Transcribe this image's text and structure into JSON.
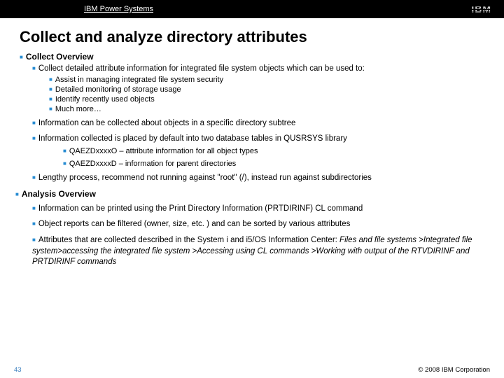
{
  "header": {
    "brand": "IBM Power Systems",
    "logo_text": "IBM"
  },
  "title": "Collect and analyze directory attributes",
  "sections": {
    "collect_overview": {
      "heading": "Collect Overview",
      "items": {
        "collect_detailed": "Collect detailed attribute information for integrated file system objects which can be used to:",
        "sub": {
          "assist": "Assist in managing integrated file system security",
          "monitoring": "Detailed monitoring of storage usage",
          "identify": "Identify recently used objects",
          "more": "Much more…"
        },
        "subtree": "Information can be collected about objects in a specific directory subtree",
        "placed": "Information collected is placed by default into two database tables in QUSRSYS library",
        "tables": {
          "o": "QAEZDxxxxO – attribute information for all object types",
          "d": "QAEZDxxxxD – information for parent directories"
        },
        "lengthy": "Lengthy process, recommend not running against \"root\" (/), instead run against subdirectories"
      }
    },
    "analysis_overview": {
      "heading": "Analysis Overview",
      "items": {
        "printed": "Information can be printed using the Print Directory Information (PRTDIRINF) CL command",
        "filtered": "Object reports can be filtered (owner, size, etc. ) and can be sorted by various attributes",
        "attrs_a": "Attributes that are collected described in the System i  and i5/OS Information Center:  ",
        "attrs_b": "Files and file systems >Integrated file system>accessing the integrated file system >Accessing using CL commands >Working with output of the RTVDIRINF and PRTDIRINF commands"
      }
    }
  },
  "footer": {
    "page": "43",
    "copyright": "© 2008 IBM Corporation"
  }
}
